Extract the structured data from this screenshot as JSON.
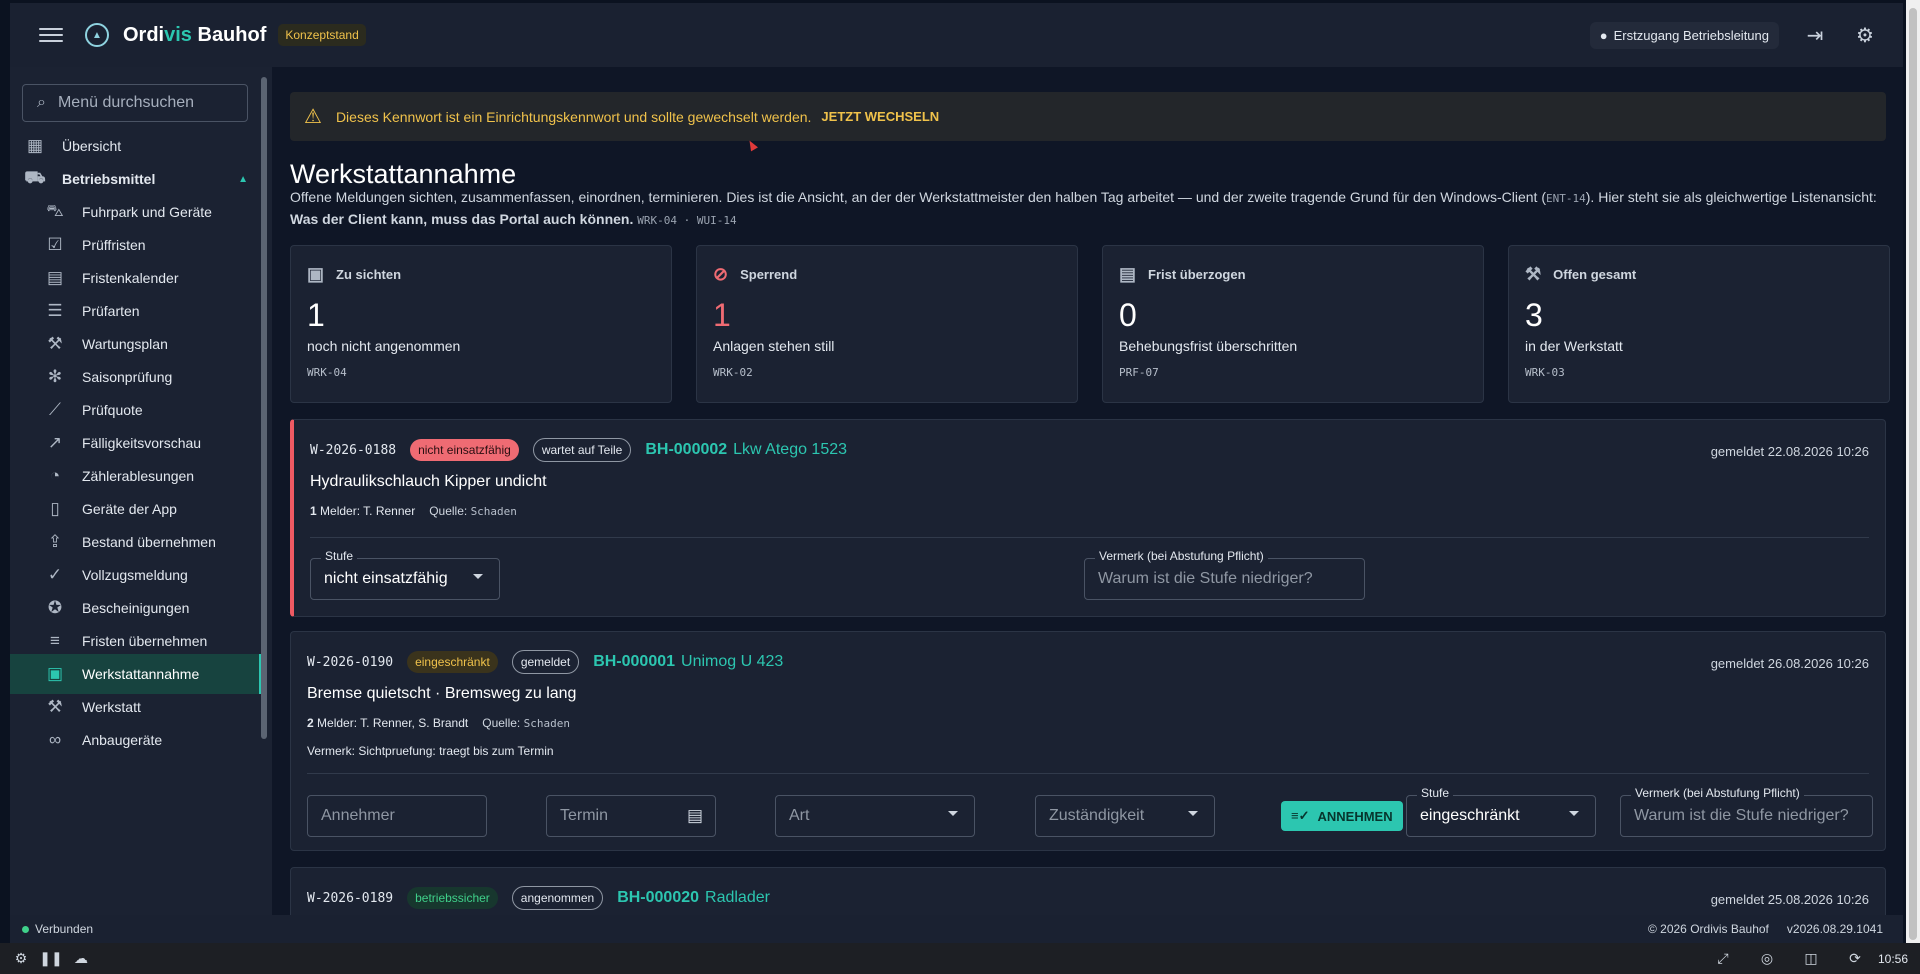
{
  "topbar": {
    "brand_a": "Ordi",
    "brand_b": "vis",
    "brand_c": " Bauhof",
    "badge": "Konzeptstand",
    "user": "Erstzugang Betriebsleitung"
  },
  "sidebar": {
    "search_placeholder": "Menü durchsuchen",
    "items": [
      {
        "label": "Übersicht",
        "icon": "dashboard-icon"
      },
      {
        "label": "Betriebsmittel",
        "icon": "truck-icon"
      },
      {
        "label": "Fuhrpark und Geräte",
        "icon": "car-icon"
      },
      {
        "label": "Prüffristen",
        "icon": "calendar-check-icon"
      },
      {
        "label": "Fristenkalender",
        "icon": "calendar-icon"
      },
      {
        "label": "Prüfarten",
        "icon": "checklist-icon"
      },
      {
        "label": "Wartungsplan",
        "icon": "wrench-icon"
      },
      {
        "label": "Saisonprüfung",
        "icon": "snowflake-icon"
      },
      {
        "label": "Prüfquote",
        "icon": "chart-icon"
      },
      {
        "label": "Fälligkeitsvorschau",
        "icon": "trend-icon"
      },
      {
        "label": "Zählerablesungen",
        "icon": "gauge-icon"
      },
      {
        "label": "Geräte der App",
        "icon": "phone-icon"
      },
      {
        "label": "Bestand übernehmen",
        "icon": "file-upload-icon"
      },
      {
        "label": "Vollzugsmeldung",
        "icon": "clipboard-check-icon"
      },
      {
        "label": "Bescheinigungen",
        "icon": "badge-check-icon"
      },
      {
        "label": "Fristen übernehmen",
        "icon": "list-check-icon"
      },
      {
        "label": "Werkstattannahme",
        "icon": "inbox-icon"
      },
      {
        "label": "Werkstatt",
        "icon": "wrench-icon"
      },
      {
        "label": "Anbaugeräte",
        "icon": "link-icon"
      }
    ]
  },
  "alert": {
    "text": "Dieses Kennwort ist ein Einrichtungskennwort und sollte gewechselt werden.",
    "action": "JETZT WECHSELN"
  },
  "page": {
    "title": "Werkstattannahme",
    "desc_1": "Offene Meldungen sichten, zusammenfassen, einordnen, terminieren. Dies ist die Ansicht, an der der Werkstattmeister den halben Tag arbeitet — und der zweite tragende Grund für den Windows-Client (",
    "desc_code": "ENT-14",
    "desc_2": "). Hier steht sie als gleichwertige Listenansicht: ",
    "desc_bold": "Was der Client kann, muss das Portal auch können.",
    "desc_codes": "WRK-04 · WUI-14"
  },
  "kpis": [
    {
      "label": "Zu sichten",
      "value": "1",
      "sub": "noch nicht angenommen",
      "code": "WRK-04"
    },
    {
      "label": "Sperrend",
      "value": "1",
      "sub": "Anlagen stehen still",
      "code": "WRK-02"
    },
    {
      "label": "Frist überzogen",
      "value": "0",
      "sub": "Behebungsfrist überschritten",
      "code": "PRF-07"
    },
    {
      "label": "Offen gesamt",
      "value": "3",
      "sub": "in der Werkstatt",
      "code": "WRK-03"
    }
  ],
  "cards": [
    {
      "no": "W-2026-0188",
      "status": "nicht einsatzfähig",
      "state": "wartet auf Teile",
      "asset_id": "BH-000002",
      "asset_name": "Lkw Atego 1523",
      "reported": "gemeldet 22.08.2026 10:26",
      "title": "Hydraulikschlauch Kipper undicht",
      "count": "1",
      "melder": "Melder: T. Renner",
      "quelle_label": "Quelle:",
      "quelle": "Schaden",
      "stufe_label": "Stufe",
      "stufe": "nicht einsatzfähig",
      "vermerk_label": "Vermerk (bei Abstufung Pflicht)",
      "vermerk_placeholder": "Warum ist die Stufe niedriger?"
    },
    {
      "no": "W-2026-0190",
      "status": "eingeschränkt",
      "state": "gemeldet",
      "asset_id": "BH-000001",
      "asset_name": "Unimog U 423",
      "reported": "gemeldet 26.08.2026 10:26",
      "title": "Bremse quietscht · Bremsweg zu lang",
      "count": "2",
      "melder": "Melder: T. Renner, S. Brandt",
      "quelle_label": "Quelle:",
      "quelle": "Schaden",
      "note": "Vermerk: Sichtpruefung: traegt bis zum Termin",
      "annehmer_placeholder": "Annehmer",
      "termin_placeholder": "Termin",
      "art_placeholder": "Art",
      "zust_placeholder": "Zuständigkeit",
      "accept": "ANNEHMEN",
      "stufe_label": "Stufe",
      "stufe": "eingeschränkt",
      "vermerk_label": "Vermerk (bei Abstufung Pflicht)",
      "vermerk_placeholder": "Warum ist die Stufe niedriger?"
    },
    {
      "no": "W-2026-0189",
      "status": "betriebssicher",
      "state": "angenommen",
      "asset_id": "BH-000020",
      "asset_name": "Radlader",
      "reported": "gemeldet 25.08.2026 10:26"
    }
  ],
  "statusbar": {
    "connected": "Verbunden",
    "copyright": "© 2026 Ordivis Bauhof",
    "version": "v2026.08.29.1041"
  },
  "taskbar": {
    "time": "10:56"
  }
}
